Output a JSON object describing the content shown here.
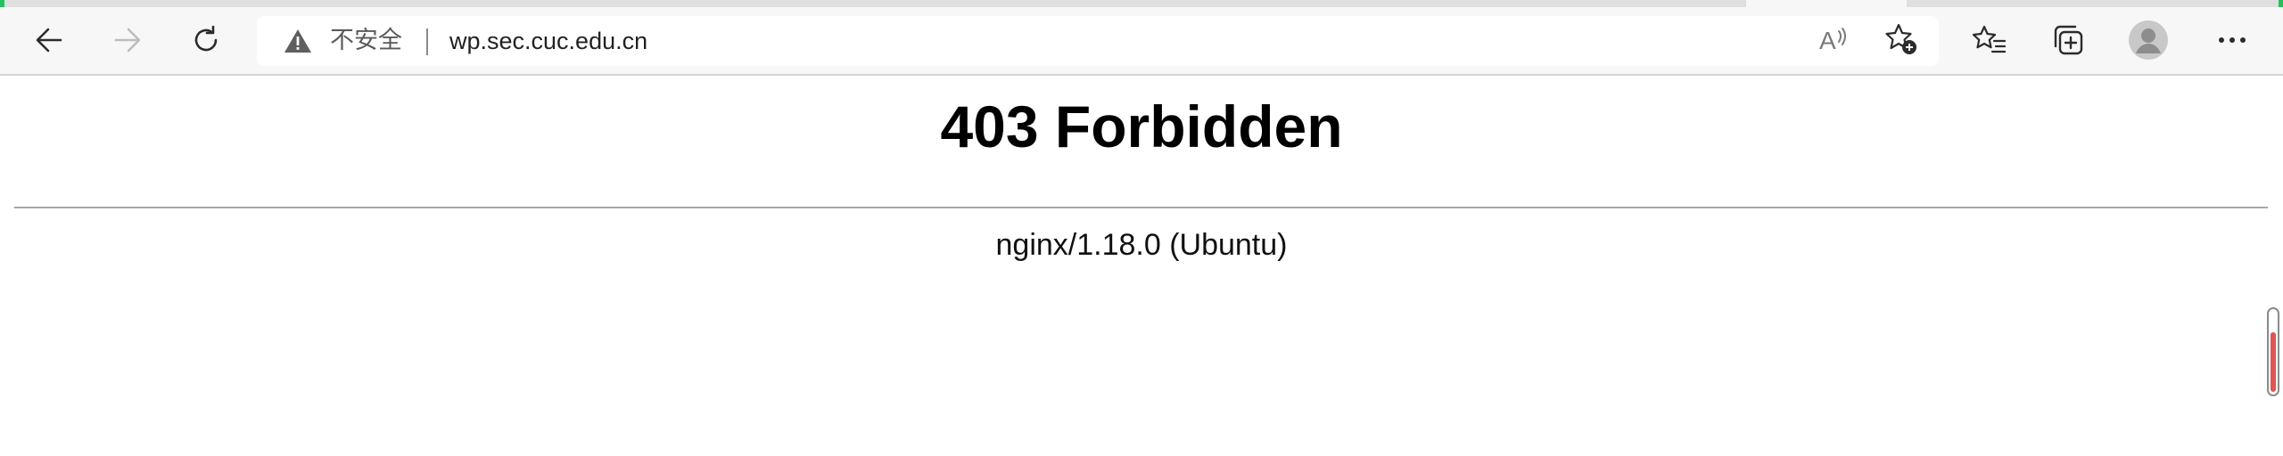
{
  "colors": {
    "accent_green": "#21c25b",
    "scroll_thumb": "#e05555"
  },
  "toolbar": {
    "back_icon": "arrow-left-icon",
    "forward_icon": "arrow-right-icon",
    "refresh_icon": "refresh-icon",
    "read_aloud_icon": "read-aloud-icon",
    "add_favorite_icon": "star-add-icon",
    "favorites_icon": "favorites-list-icon",
    "collections_icon": "collections-icon",
    "profile_icon": "avatar-icon",
    "menu_icon": "more-icon"
  },
  "address_bar": {
    "security_label": "不安全",
    "url": "wp.sec.cuc.edu.cn"
  },
  "page": {
    "title": "403 Forbidden",
    "server_info": "nginx/1.18.0 (Ubuntu)"
  },
  "scrollbar": {
    "position_fraction": 0.85,
    "thumb_fraction": 0.7
  }
}
